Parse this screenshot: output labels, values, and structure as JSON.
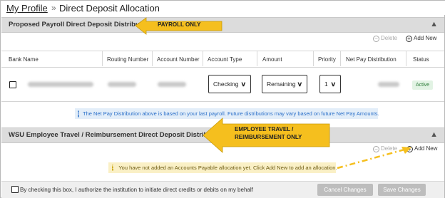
{
  "header": {
    "profile_link": "My Profile",
    "separator": "»",
    "title": "Direct Deposit Allocation"
  },
  "payroll": {
    "section_title": "Proposed Payroll Direct Deposit Distribution",
    "collapse_glyph": "▲",
    "delete_label": "Delete",
    "add_label": "Add New",
    "columns": [
      "Bank Name",
      "Routing Number",
      "Account Number",
      "Account Type",
      "Amount",
      "Priority",
      "Net Pay Distribution",
      "Status"
    ],
    "row": {
      "account_type": "Checking",
      "amount": "Remaining",
      "priority": "1",
      "status": "Active"
    },
    "info_text": "The Net Pay Distribution above is based on your last payroll. Future distributions may vary based on future Net Pay Amounts."
  },
  "travel": {
    "section_title": "WSU Employee Travel / Reimbursement Direct Deposit Distribution",
    "collapse_glyph": "▲",
    "delete_label": "Delete",
    "add_label": "Add New",
    "warning_text": "You have not added an Accounts Payable allocation yet. Click Add New to add an allocation."
  },
  "footer": {
    "authorize_text": "By checking this box, I authorize the institution to initiate direct credits or debits on my behalf",
    "cancel_label": "Cancel Changes",
    "save_label": "Save Changes"
  },
  "callouts": {
    "payroll": "PAYROLL ONLY",
    "travel_line1": "EMPLOYEE TRAVEL /",
    "travel_line2": "REIMBURSEMENT ONLY",
    "color": "#f5bf1e"
  }
}
